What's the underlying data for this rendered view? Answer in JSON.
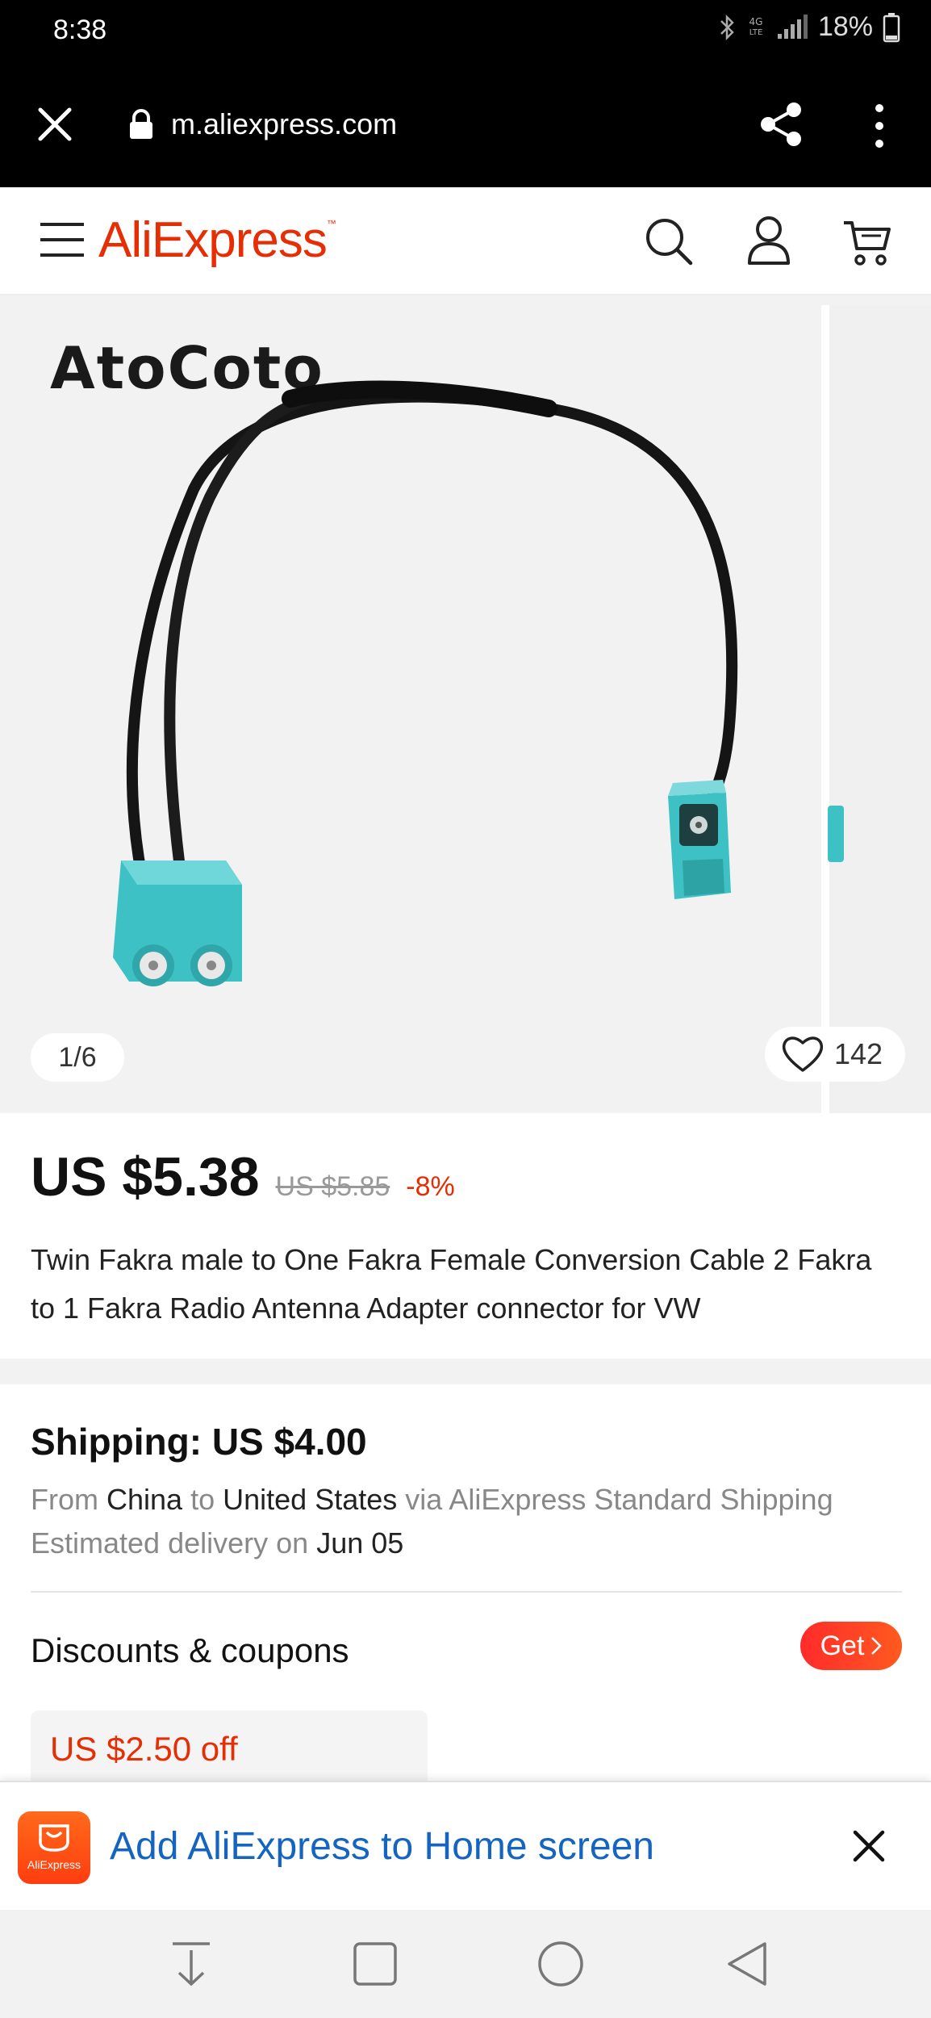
{
  "status_bar": {
    "time": "8:38",
    "battery": "18%"
  },
  "browser": {
    "url": "m.aliexpress.com"
  },
  "header": {
    "logo": "AliExpress",
    "logo_mark": "™"
  },
  "gallery": {
    "brand_watermark": "AtoCoto",
    "counter": "1/6",
    "wishlist_count": "142"
  },
  "product": {
    "price": "US $5.38",
    "original_price": "US $5.85",
    "discount": "-8%",
    "title": "Twin Fakra male to One Fakra Female Conversion Cable 2 Fakra to 1 Fakra Radio Antenna Adapter connector for VW"
  },
  "shipping": {
    "title": "Shipping: US $4.00",
    "from_label": "From",
    "from": "China",
    "to_label": "to",
    "to": "United States",
    "via": "via AliExpress Standard Shipping",
    "delivery_label": "Estimated delivery on",
    "delivery_date": "Jun 05"
  },
  "discounts": {
    "title": "Discounts & coupons",
    "get_label": "Get",
    "coupon_value": "US $2.50 off"
  },
  "install_banner": {
    "app_label": "AliExpress",
    "text": "Add AliExpress to Home screen"
  },
  "colors": {
    "brand": "#e62e04",
    "link": "#1565c0",
    "connector": "#3ec1c4"
  }
}
